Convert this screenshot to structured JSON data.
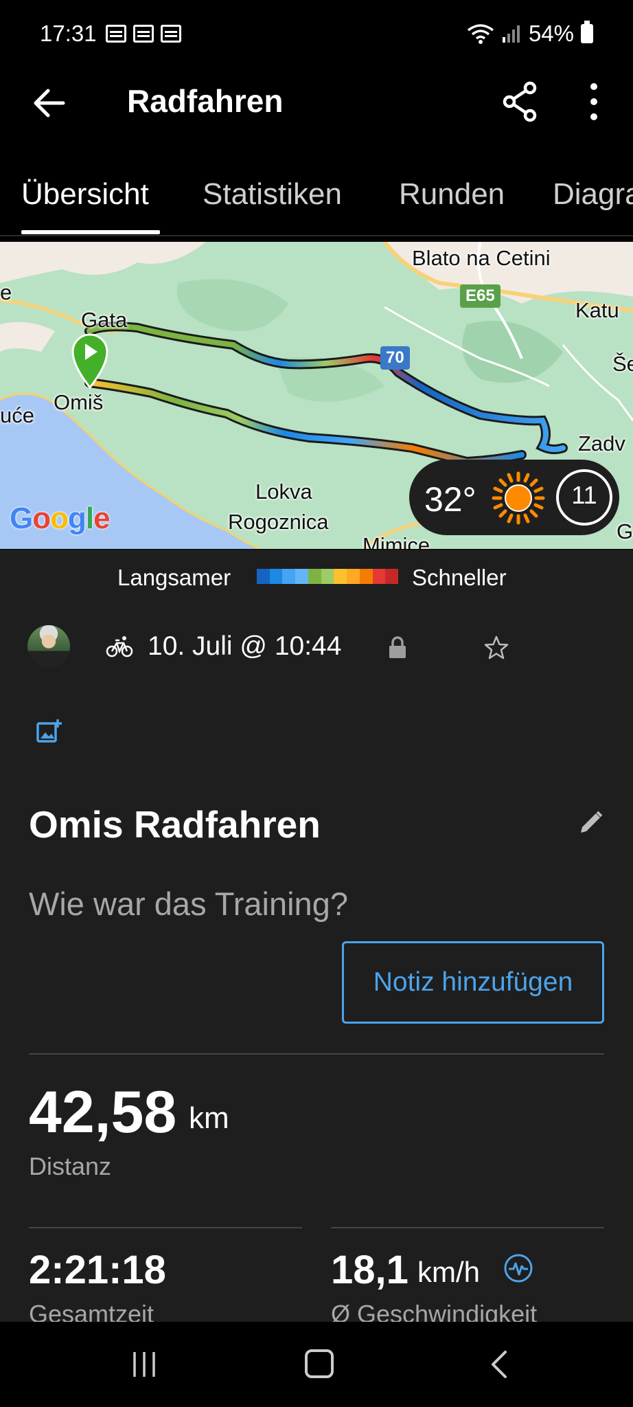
{
  "status_bar": {
    "time": "17:31",
    "battery": "54%"
  },
  "app_bar": {
    "title": "Radfahren"
  },
  "tabs": [
    {
      "label": "Übersicht",
      "active": true
    },
    {
      "label": "Statistiken",
      "active": false
    },
    {
      "label": "Runden",
      "active": false
    },
    {
      "label": "Diagramme",
      "active": false
    }
  ],
  "map": {
    "labels": {
      "blato": "Blato na Cetini",
      "gata": "Gata",
      "katu": "Katu",
      "se": "Še",
      "omis": "Omiš",
      "uce": "uće",
      "zadv": "Zadv",
      "lokva": "Lokva",
      "rogoznica": "Rogoznica",
      "mimice": "Mimice",
      "e": "e",
      "g": "G"
    },
    "roads": {
      "e65": "E65",
      "r70": "70"
    },
    "attribution": "Google",
    "weather": {
      "temperature": "32°",
      "condition_icon": "sun-icon",
      "moon_phase": "11"
    }
  },
  "legend": {
    "slow": "Langsamer",
    "fast": "Schneller",
    "colors": [
      "#1565c0",
      "#1e88e5",
      "#42a5f5",
      "#64b5f6",
      "#7cb342",
      "#9ccc65",
      "#fbc02d",
      "#ffa726",
      "#f57c00",
      "#e53935",
      "#c62828"
    ]
  },
  "activity": {
    "date": "10. Juli @ 10:44",
    "title": "Omis Radfahren",
    "question": "Wie war das Training?",
    "note_button": "Notiz hinzufügen"
  },
  "stats": {
    "distance": {
      "value": "42,58",
      "unit": "km",
      "label": "Distanz"
    },
    "total_time": {
      "value": "2:21:18",
      "label": "Gesamtzeit"
    },
    "avg_speed": {
      "value": "18,1",
      "unit": "km/h",
      "label": "Ø Geschwindigkeit"
    }
  },
  "colors": {
    "accent": "#4da3ea",
    "background": "#1e1e1e",
    "start_marker": "#43b02a"
  }
}
